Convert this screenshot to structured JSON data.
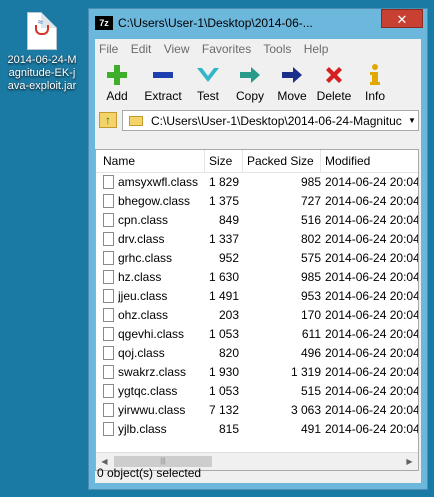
{
  "desktop": {
    "icon_label": "2014-06-24-Magnitude-EK-java-exploit.jar"
  },
  "window": {
    "title": "C:\\Users\\User-1\\Desktop\\2014-06-...",
    "app_icon": "7z",
    "close_symbol": "✕"
  },
  "menu": [
    "File",
    "Edit",
    "View",
    "Favorites",
    "Tools",
    "Help"
  ],
  "toolbar": [
    {
      "label": "Add",
      "icon": "plus-icon",
      "color": "#3fae2a"
    },
    {
      "label": "Extract",
      "icon": "minus-icon",
      "color": "#1e3fb0"
    },
    {
      "label": "Test",
      "icon": "check-icon",
      "color": "#32b6c8"
    },
    {
      "label": "Copy",
      "icon": "copy-arrow-icon",
      "color": "#2a9a8a"
    },
    {
      "label": "Move",
      "icon": "move-arrow-icon",
      "color": "#1b2f8a"
    },
    {
      "label": "Delete",
      "icon": "delete-x-icon",
      "color": "#d42020"
    },
    {
      "label": "Info",
      "icon": "info-icon",
      "color": "#e0a800"
    }
  ],
  "address": {
    "path": "C:\\Users\\User-1\\Desktop\\2014-06-24-Magnituc"
  },
  "columns": [
    "Name",
    "Size",
    "Packed Size",
    "Modified"
  ],
  "files": [
    {
      "name": "amsyxwfl.class",
      "size": "1 829",
      "packed": "985",
      "modified": "2014-06-24 20:04"
    },
    {
      "name": "bhegow.class",
      "size": "1 375",
      "packed": "727",
      "modified": "2014-06-24 20:04"
    },
    {
      "name": "cpn.class",
      "size": "849",
      "packed": "516",
      "modified": "2014-06-24 20:04"
    },
    {
      "name": "drv.class",
      "size": "1 337",
      "packed": "802",
      "modified": "2014-06-24 20:04"
    },
    {
      "name": "grhc.class",
      "size": "952",
      "packed": "575",
      "modified": "2014-06-24 20:04"
    },
    {
      "name": "hz.class",
      "size": "1 630",
      "packed": "985",
      "modified": "2014-06-24 20:04"
    },
    {
      "name": "jjeu.class",
      "size": "1 491",
      "packed": "953",
      "modified": "2014-06-24 20:04"
    },
    {
      "name": "ohz.class",
      "size": "203",
      "packed": "170",
      "modified": "2014-06-24 20:04"
    },
    {
      "name": "qgevhi.class",
      "size": "1 053",
      "packed": "611",
      "modified": "2014-06-24 20:04"
    },
    {
      "name": "qoj.class",
      "size": "820",
      "packed": "496",
      "modified": "2014-06-24 20:04"
    },
    {
      "name": "swakrz.class",
      "size": "1 930",
      "packed": "1 319",
      "modified": "2014-06-24 20:04"
    },
    {
      "name": "ygtqc.class",
      "size": "1 053",
      "packed": "515",
      "modified": "2014-06-24 20:04"
    },
    {
      "name": "yirwwu.class",
      "size": "7 132",
      "packed": "3 063",
      "modified": "2014-06-24 20:04"
    },
    {
      "name": "yjlb.class",
      "size": "815",
      "packed": "491",
      "modified": "2014-06-24 20:04"
    }
  ],
  "status": {
    "text": "0 object(s) selected"
  }
}
